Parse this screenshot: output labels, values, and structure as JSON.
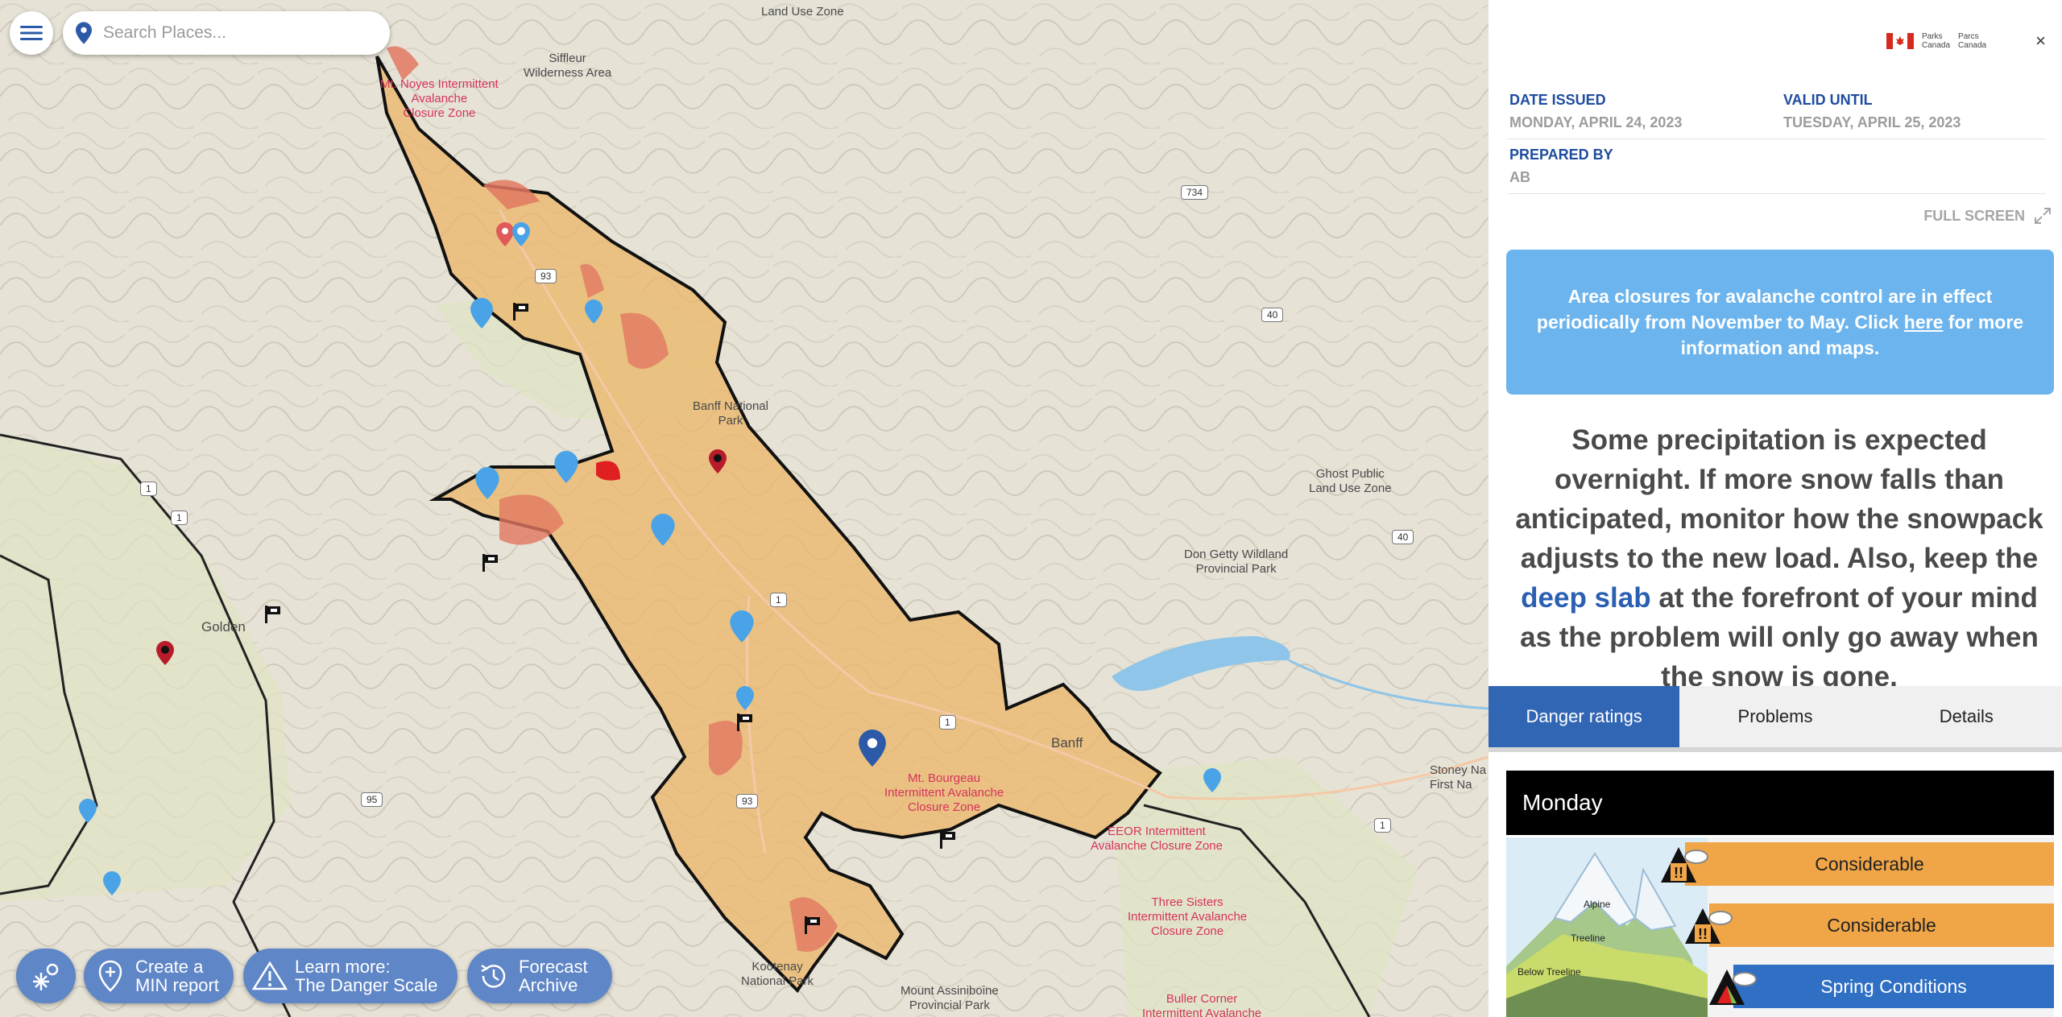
{
  "search": {
    "placeholder": "Search Places..."
  },
  "map": {
    "labels": {
      "siffleur": "Siffleur\nWilderness Area",
      "land_use_top": "Land Use Zone",
      "banff_np": "Banff National\nPark",
      "ghost": "Ghost Public\nLand Use Zone",
      "don_getty": "Don Getty Wildland\nProvincial Park",
      "golden": "Golden",
      "banff": "Banff",
      "kootenay": "Kootenay\nNational Park",
      "assiniboine": "Mount Assiniboine\nProvincial Park",
      "stoney": "Stoney Na\nFirst Na"
    },
    "closure_labels": {
      "noyes": "Mt. Noyes Intermittent\nAvalanche\nClosure Zone",
      "bourgeau": "Mt. Bourgeau\nIntermittent Avalanche\nClosure Zone",
      "eeor": "EEOR Intermittent\nAvalanche Closure Zone",
      "three_sisters": "Three Sisters\nIntermittent Avalanche\nClosure Zone",
      "buller": "Buller Corner\nIntermittent Avalanche"
    },
    "roads": {
      "r734": "734",
      "r40a": "40",
      "r40b": "40",
      "r93a": "93",
      "r93b": "93",
      "r1a": "1",
      "r1b": "1",
      "r1c": "1",
      "r1d": "1",
      "r1e": "1",
      "r95": "95"
    }
  },
  "bottom_buttons": {
    "create_min": "Create a\nMIN report",
    "learn_more": "Learn more:\nThe Danger Scale",
    "forecast_archive": "Forecast\nArchive"
  },
  "panel": {
    "logo_text_en": "Parks\nCanada",
    "logo_text_fr": "Parcs\nCanada",
    "close": "×",
    "date_issued_label": "DATE ISSUED",
    "date_issued_value": "MONDAY, APRIL 24, 2023",
    "valid_until_label": "VALID UNTIL",
    "valid_until_value": "TUESDAY, APRIL 25, 2023",
    "prepared_by_label": "PREPARED BY",
    "prepared_by_value": "AB",
    "full_screen": "FULL SCREEN",
    "notice_before": "Area closures for avalanche control are in effect periodically from November to May. Click ",
    "notice_link": "here",
    "notice_after": " for more information and maps.",
    "highlight_1": "Some precipitation is expected overnight. If more snow falls than anticipated, monitor how the snowpack adjusts to the new load. Also, keep the ",
    "highlight_em": "deep slab",
    "highlight_2": " at the forefront of your mind as the problem will only go away when the snow is gone.",
    "tabs": [
      "Danger ratings",
      "Problems",
      "Details"
    ],
    "day": "Monday",
    "elevations": [
      "Alpine",
      "Treeline",
      "Below Treeline"
    ],
    "ratings": [
      "Considerable",
      "Considerable",
      "Spring Conditions"
    ],
    "colors": {
      "considerable": "#f0a546",
      "spring": "#2f6fc4",
      "accent": "#3166b5"
    }
  }
}
